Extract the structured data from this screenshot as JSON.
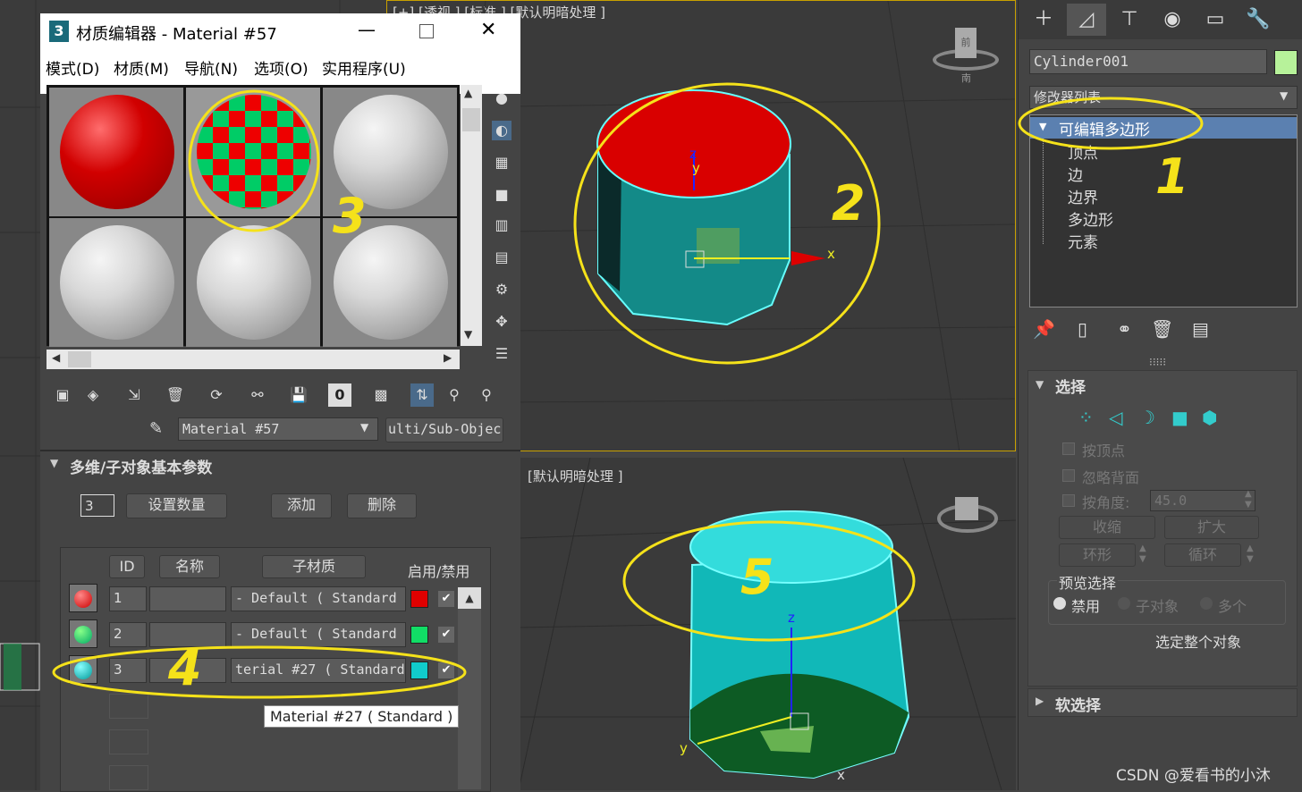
{
  "viewport_top": {
    "label": "[+] [透视 ] [标准 ] [默认明暗处理 ]",
    "axes": {
      "x": "x",
      "y": "y",
      "z": "z"
    },
    "viewcube": "前",
    "viewcube_bottom": "南"
  },
  "viewport_bottom": {
    "label": "[默认明暗处理 ]",
    "axes": {
      "x": "x",
      "y": "y",
      "z": "z"
    }
  },
  "material_editor": {
    "app_icon": "3",
    "title": "材质编辑器 - Material #57",
    "menu": [
      "模式(D)",
      "材质(M)",
      "导航(N)",
      "选项(O)",
      "实用程序(U)"
    ],
    "material_name": "Material #57",
    "material_type": "ulti/Sub-Objec",
    "rollout_title": "多维/子对象基本参数",
    "count_value": "3",
    "buttons": {
      "set_count": "设置数量",
      "add": "添加",
      "delete": "删除"
    },
    "columns": {
      "id": "ID",
      "name": "名称",
      "sub": "子材质",
      "toggle": "启用/禁用"
    },
    "rows": [
      {
        "id": "1",
        "sub": "- Default  ( Standard",
        "color": "#e00000"
      },
      {
        "id": "2",
        "sub": "- Default  ( Standard",
        "color": "#11dd66"
      },
      {
        "id": "3",
        "sub": "terial #27  ( Standard",
        "color": "#11cccc"
      }
    ],
    "tooltip": "Material #27 ( Standard )"
  },
  "command_panel": {
    "object_name": "Cylinder001",
    "object_color": "#b7f29a",
    "modifier_list": "修改器列表",
    "tree": {
      "root": "可编辑多边形",
      "children": [
        "顶点",
        "边",
        "边界",
        "多边形",
        "元素"
      ]
    },
    "selection": {
      "title": "选择",
      "by_vertex": "按顶点",
      "ignore_backfacing": "忽略背面",
      "by_angle": "按角度:",
      "angle_value": "45.0",
      "shrink": "收缩",
      "grow": "扩大",
      "ring": "环形",
      "loop": "循环",
      "preview": "预览选择",
      "preview_options": [
        "禁用",
        "子对象",
        "多个"
      ],
      "status": "选定整个对象"
    },
    "soft_selection": "软选择"
  },
  "annotations": [
    "1",
    "2",
    "3",
    "4",
    "5"
  ],
  "watermark": "CSDN @爱看书的小沐"
}
